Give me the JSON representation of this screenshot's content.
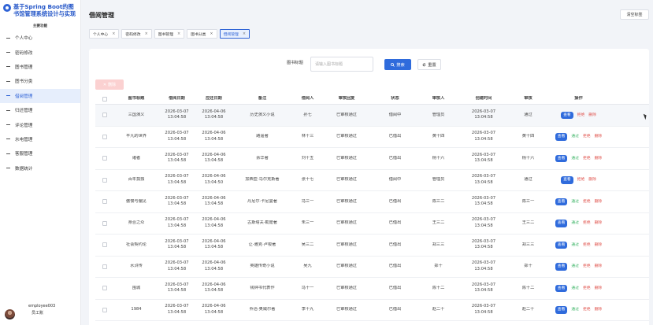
{
  "sidebar": {
    "brand_title": "基于Spring Boot的图书馆管理系统设计与实现",
    "section_title": "主要功能",
    "items": [
      {
        "label": "个人中心",
        "active": false
      },
      {
        "label": "密码修改",
        "active": false
      },
      {
        "label": "图书管理",
        "active": false
      },
      {
        "label": "图书分类",
        "active": false
      },
      {
        "label": "借阅管理",
        "active": true
      },
      {
        "label": "归还管理",
        "active": false
      },
      {
        "label": "评论管理",
        "active": false
      },
      {
        "label": "水电管理",
        "active": false
      },
      {
        "label": "客服管理",
        "active": false
      },
      {
        "label": "数据统计",
        "active": false
      }
    ],
    "user": {
      "name": "employee003",
      "role": "员工账"
    }
  },
  "header": {
    "title": "借阅管理",
    "clear_tabs_label": "清空标签",
    "tabs": [
      {
        "label": "个人中心",
        "active": false
      },
      {
        "label": "密码修改",
        "active": false
      },
      {
        "label": "图书管理",
        "active": false
      },
      {
        "label": "图书分类",
        "active": false
      },
      {
        "label": "借阅管理",
        "active": true
      }
    ]
  },
  "search": {
    "label": "图书标题",
    "placeholder": "请输入图书标题",
    "search_button": "搜索",
    "reset_button": "重置"
  },
  "toolbar": {
    "delete_button": "删除"
  },
  "table": {
    "columns": [
      "图书标题",
      "借阅日期",
      "应还日期",
      "备注",
      "借阅人",
      "审核回复",
      "状态",
      "审核人",
      "创建时间",
      "审核",
      "操作"
    ],
    "action_labels": {
      "view": "查看",
      "approve": "通过",
      "reject": "拒绝",
      "delete": "删除"
    },
    "rows": [
      {
        "title": "三国演义",
        "borrow_date": "2026-03-07",
        "borrow_time": "13:04:58",
        "due_date": "2026-04-06",
        "due_time": "13:04:58",
        "note": "历史演义小说",
        "borrower": "孙七",
        "reply": "已审核通过",
        "status": "借阅中",
        "reviewer": "管理员",
        "created_date": "2026-03-07",
        "created_time": "13:04:58",
        "review": "通过",
        "show_approve": false,
        "show_reject": true
      },
      {
        "title": "平凡的世界",
        "borrow_date": "2026-03-07",
        "borrow_time": "13:04:58",
        "due_date": "2026-04-06",
        "due_time": "13:04:58",
        "note": "路遥著",
        "borrower": "林十三",
        "reply": "已审核通过",
        "status": "已借出",
        "reviewer": "黄十四",
        "created_date": "2026-03-07",
        "created_time": "13:04:58",
        "review": "黄十四",
        "show_approve": true,
        "show_reject": true
      },
      {
        "title": "诸者",
        "borrow_date": "2026-03-07",
        "borrow_time": "13:04:58",
        "due_date": "2026-04-06",
        "due_time": "13:04:58",
        "note": "余华著",
        "borrower": "刘十五",
        "reply": "已审核通过",
        "status": "已借出",
        "reviewer": "杨十六",
        "created_date": "2026-03-07",
        "created_time": "13:04:58",
        "review": "杨十六",
        "show_approve": true,
        "show_reject": true
      },
      {
        "title": "百年孤独",
        "borrow_date": "2026-03-07",
        "borrow_time": "13:04:58",
        "due_date": "2026-04-06",
        "due_time": "13:04:50",
        "note": "加西亚·马尔克斯著",
        "borrower": "张十七",
        "reply": "已审核通过",
        "status": "借阅中",
        "reviewer": "管理员",
        "created_date": "2026-03-07",
        "created_time": "13:04:58",
        "review": "通过",
        "show_approve": false,
        "show_reject": true
      },
      {
        "title": "傲慢与偏见",
        "borrow_date": "2026-03-07",
        "borrow_time": "13:04:58",
        "due_date": "2026-04-06",
        "due_time": "13:04:58",
        "note": "丹尼尔·卡尼曼著",
        "borrower": "冯三一",
        "reply": "已审核通过",
        "status": "已借出",
        "reviewer": "陈三二",
        "created_date": "2026-03-07",
        "created_time": "13:04:58",
        "review": "陈三一",
        "show_approve": true,
        "show_reject": true
      },
      {
        "title": "身合之众",
        "borrow_date": "2026-03-07",
        "borrow_time": "13:04:58",
        "due_date": "2026-04-06",
        "due_time": "13:04:58",
        "note": "古斯塔夫·勒庞著",
        "borrower": "朱三一",
        "reply": "已审核通过",
        "status": "已借出",
        "reviewer": "王三二",
        "created_date": "2026-03-07",
        "created_time": "13:04:58",
        "review": "王三二",
        "show_approve": true,
        "show_reject": true
      },
      {
        "title": "社会契约论",
        "borrow_date": "2026-03-07",
        "borrow_time": "13:04:58",
        "due_date": "2026-04-06",
        "due_time": "13:04:58",
        "note": "让-雅克·卢梭著",
        "borrower": "吴三二",
        "reply": "已审核通过",
        "status": "已借出",
        "reviewer": "郑三三",
        "created_date": "2026-03-07",
        "created_time": "13:04:58",
        "review": "郑三三",
        "show_approve": true,
        "show_reject": true
      },
      {
        "title": "水浒传",
        "borrow_date": "2026-03-07",
        "borrow_time": "13:04:58",
        "due_date": "2026-04-06",
        "due_time": "13:04:58",
        "note": "英雄传奇小说",
        "borrower": "吴九",
        "reply": "已审核通过",
        "status": "已借出",
        "reviewer": "郑十",
        "created_date": "2026-03-07",
        "created_time": "13:04:58",
        "review": "郑十",
        "show_approve": true,
        "show_reject": true
      },
      {
        "title": "围城",
        "borrow_date": "2026-03-07",
        "borrow_time": "13:04:58",
        "due_date": "2026-04-06",
        "due_time": "13:04:58",
        "note": "钱钟书代表作",
        "borrower": "冯十一",
        "reply": "已审核通过",
        "status": "已借出",
        "reviewer": "陈十二",
        "created_date": "2026-03-07",
        "created_time": "13:04:58",
        "review": "陈十二",
        "show_approve": true,
        "show_reject": true
      },
      {
        "title": "1984",
        "borrow_date": "2026-03-07",
        "borrow_time": "13:04:58",
        "due_date": "2026-04-06",
        "due_time": "13:04:58",
        "note": "乔治·奥威尔著",
        "borrower": "李十九",
        "reply": "已审核通过",
        "status": "已借出",
        "reviewer": "赵二十",
        "created_date": "2026-03-07",
        "created_time": "13:04:58",
        "review": "赵二十",
        "show_approve": true,
        "show_reject": true
      }
    ]
  }
}
